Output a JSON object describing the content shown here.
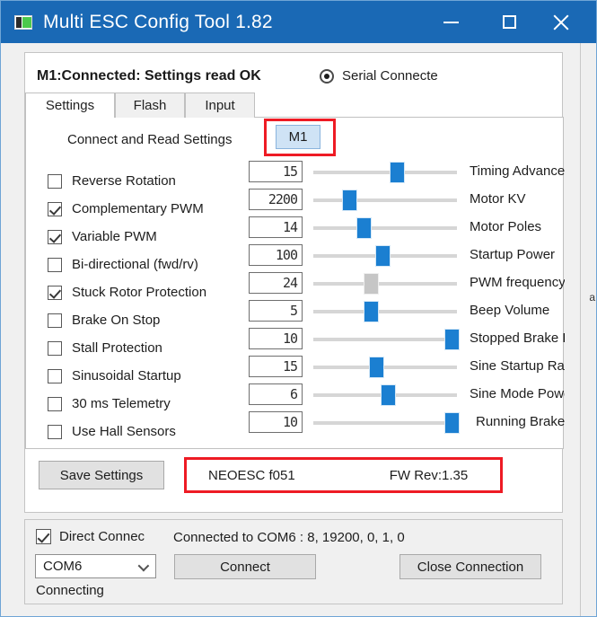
{
  "window": {
    "title": "Multi ESC Config Tool 1.82",
    "icon": "esc-device-icon",
    "controls": {
      "minimize": "minimize-icon",
      "maximize": "maximize-icon",
      "close": "close-icon"
    },
    "accent_color": "#1a69b5",
    "highlight_color": "#ee1b24",
    "slider_color": "#1b7fd1",
    "slider_disabled_color": "#c6c6c6"
  },
  "header": {
    "status": "M1:Connected: Settings read OK",
    "serial_radio_label": "Serial Connecte",
    "serial_radio_selected": true
  },
  "tabs": [
    {
      "label": "Settings",
      "active": true
    },
    {
      "label": "Flash",
      "active": false
    },
    {
      "label": "Input",
      "active": false
    }
  ],
  "connect_read": {
    "label": "Connect and Read Settings",
    "motor_button": "M1",
    "highlighted": true
  },
  "checkboxes": [
    {
      "label": "Reverse Rotation",
      "checked": false
    },
    {
      "label": "Complementary PWM",
      "checked": true
    },
    {
      "label": "Variable PWM",
      "checked": true
    },
    {
      "label": "Bi-directional (fwd/rv)",
      "checked": false
    },
    {
      "label": "Stuck Rotor Protection",
      "checked": true
    },
    {
      "label": "Brake On Stop",
      "checked": false
    },
    {
      "label": "Stall Protection",
      "checked": false
    },
    {
      "label": "Sinusoidal Startup",
      "checked": false
    },
    {
      "label": "30 ms Telemetry",
      "checked": false
    },
    {
      "label": "Use Hall Sensors",
      "checked": false
    }
  ],
  "sliders": [
    {
      "label": "Timing Advance",
      "value": "15",
      "percent": 58,
      "disabled": false,
      "indent": false
    },
    {
      "label": "Motor KV",
      "value": "2200",
      "percent": 25,
      "disabled": false,
      "indent": false
    },
    {
      "label": "Motor Poles",
      "value": "14",
      "percent": 35,
      "disabled": false,
      "indent": false
    },
    {
      "label": "Startup Power",
      "value": "100",
      "percent": 48,
      "disabled": false,
      "indent": false
    },
    {
      "label": "PWM frequency",
      "value": "24",
      "percent": 40,
      "disabled": true,
      "indent": false
    },
    {
      "label": "Beep Volume",
      "value": "5",
      "percent": 40,
      "disabled": false,
      "indent": false
    },
    {
      "label": "Stopped Brake Lev",
      "value": "10",
      "percent": 96,
      "disabled": false,
      "indent": false
    },
    {
      "label": "Sine Startup Ran",
      "value": "15",
      "percent": 44,
      "disabled": false,
      "indent": false
    },
    {
      "label": "Sine Mode Powe",
      "value": "6",
      "percent": 52,
      "disabled": false,
      "indent": false
    },
    {
      "label": "Running Brake Le",
      "value": "10",
      "percent": 96,
      "disabled": false,
      "indent": true
    }
  ],
  "footer": {
    "save_label": "Save Settings",
    "fw_model": "NEOESC f051",
    "fw_rev": "FW Rev:1.35",
    "fw_highlighted": true
  },
  "connection": {
    "direct_connect_label": "Direct Connec",
    "direct_connect_checked": true,
    "status": "Connected to COM6 : 8, 19200, 0, 1, 0",
    "com_port": "COM6",
    "connect_label": "Connect",
    "close_label": "Close Connection",
    "activity": "Connecting"
  },
  "background": {
    "sliver_text": "a"
  }
}
